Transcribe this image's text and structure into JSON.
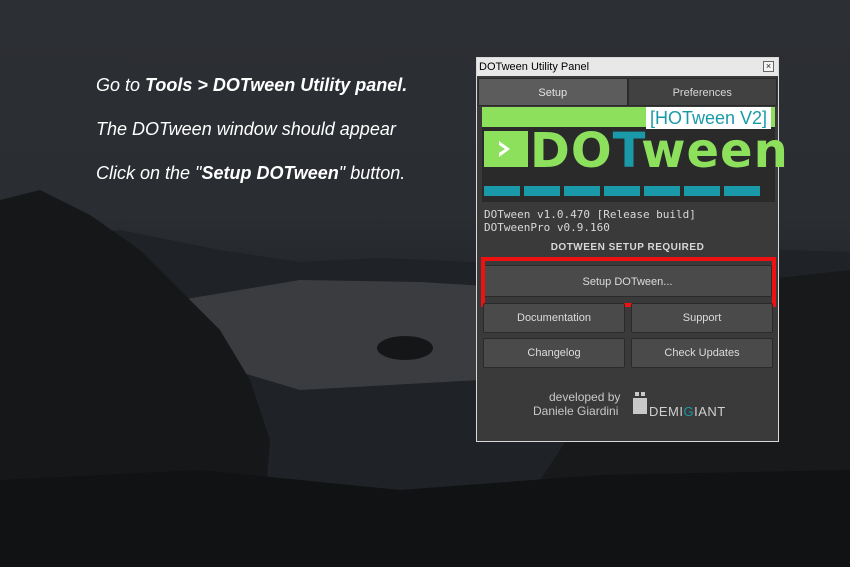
{
  "instructions": {
    "line1_a": "Go to ",
    "line1_b": "Tools > DOTween Utility panel.",
    "line2": "The DOTween window should appear",
    "line3_a": "Click on the \"",
    "line3_b": "Setup DOTween",
    "line3_c": "\" button."
  },
  "panel": {
    "title": "DOTween Utility Panel",
    "close_icon": "close-icon",
    "tabs": [
      {
        "label": "Setup",
        "active": true
      },
      {
        "label": "Preferences",
        "active": false
      }
    ],
    "logo": {
      "badge": "[HOTween V2]",
      "word_green": "DO",
      "word_blue": "T",
      "word_rest": "ween"
    },
    "version_line1": "DOTween v1.0.470 [Release build]",
    "version_line2": "DOTweenPro v0.9.160",
    "setup_required": "DOTWEEN SETUP REQUIRED",
    "buttons": {
      "setup": "Setup DOTween...",
      "documentation": "Documentation",
      "support": "Support",
      "changelog": "Changelog",
      "check_updates": "Check Updates"
    },
    "credit": {
      "developed_by": "developed by",
      "author": "Daniele Giardini",
      "company_a": "DEMI",
      "company_g": "G",
      "company_b": "IANT"
    }
  },
  "colors": {
    "brand_green": "#8ce05c",
    "brand_blue": "#1a9aa8",
    "highlight": "#ee1111"
  }
}
